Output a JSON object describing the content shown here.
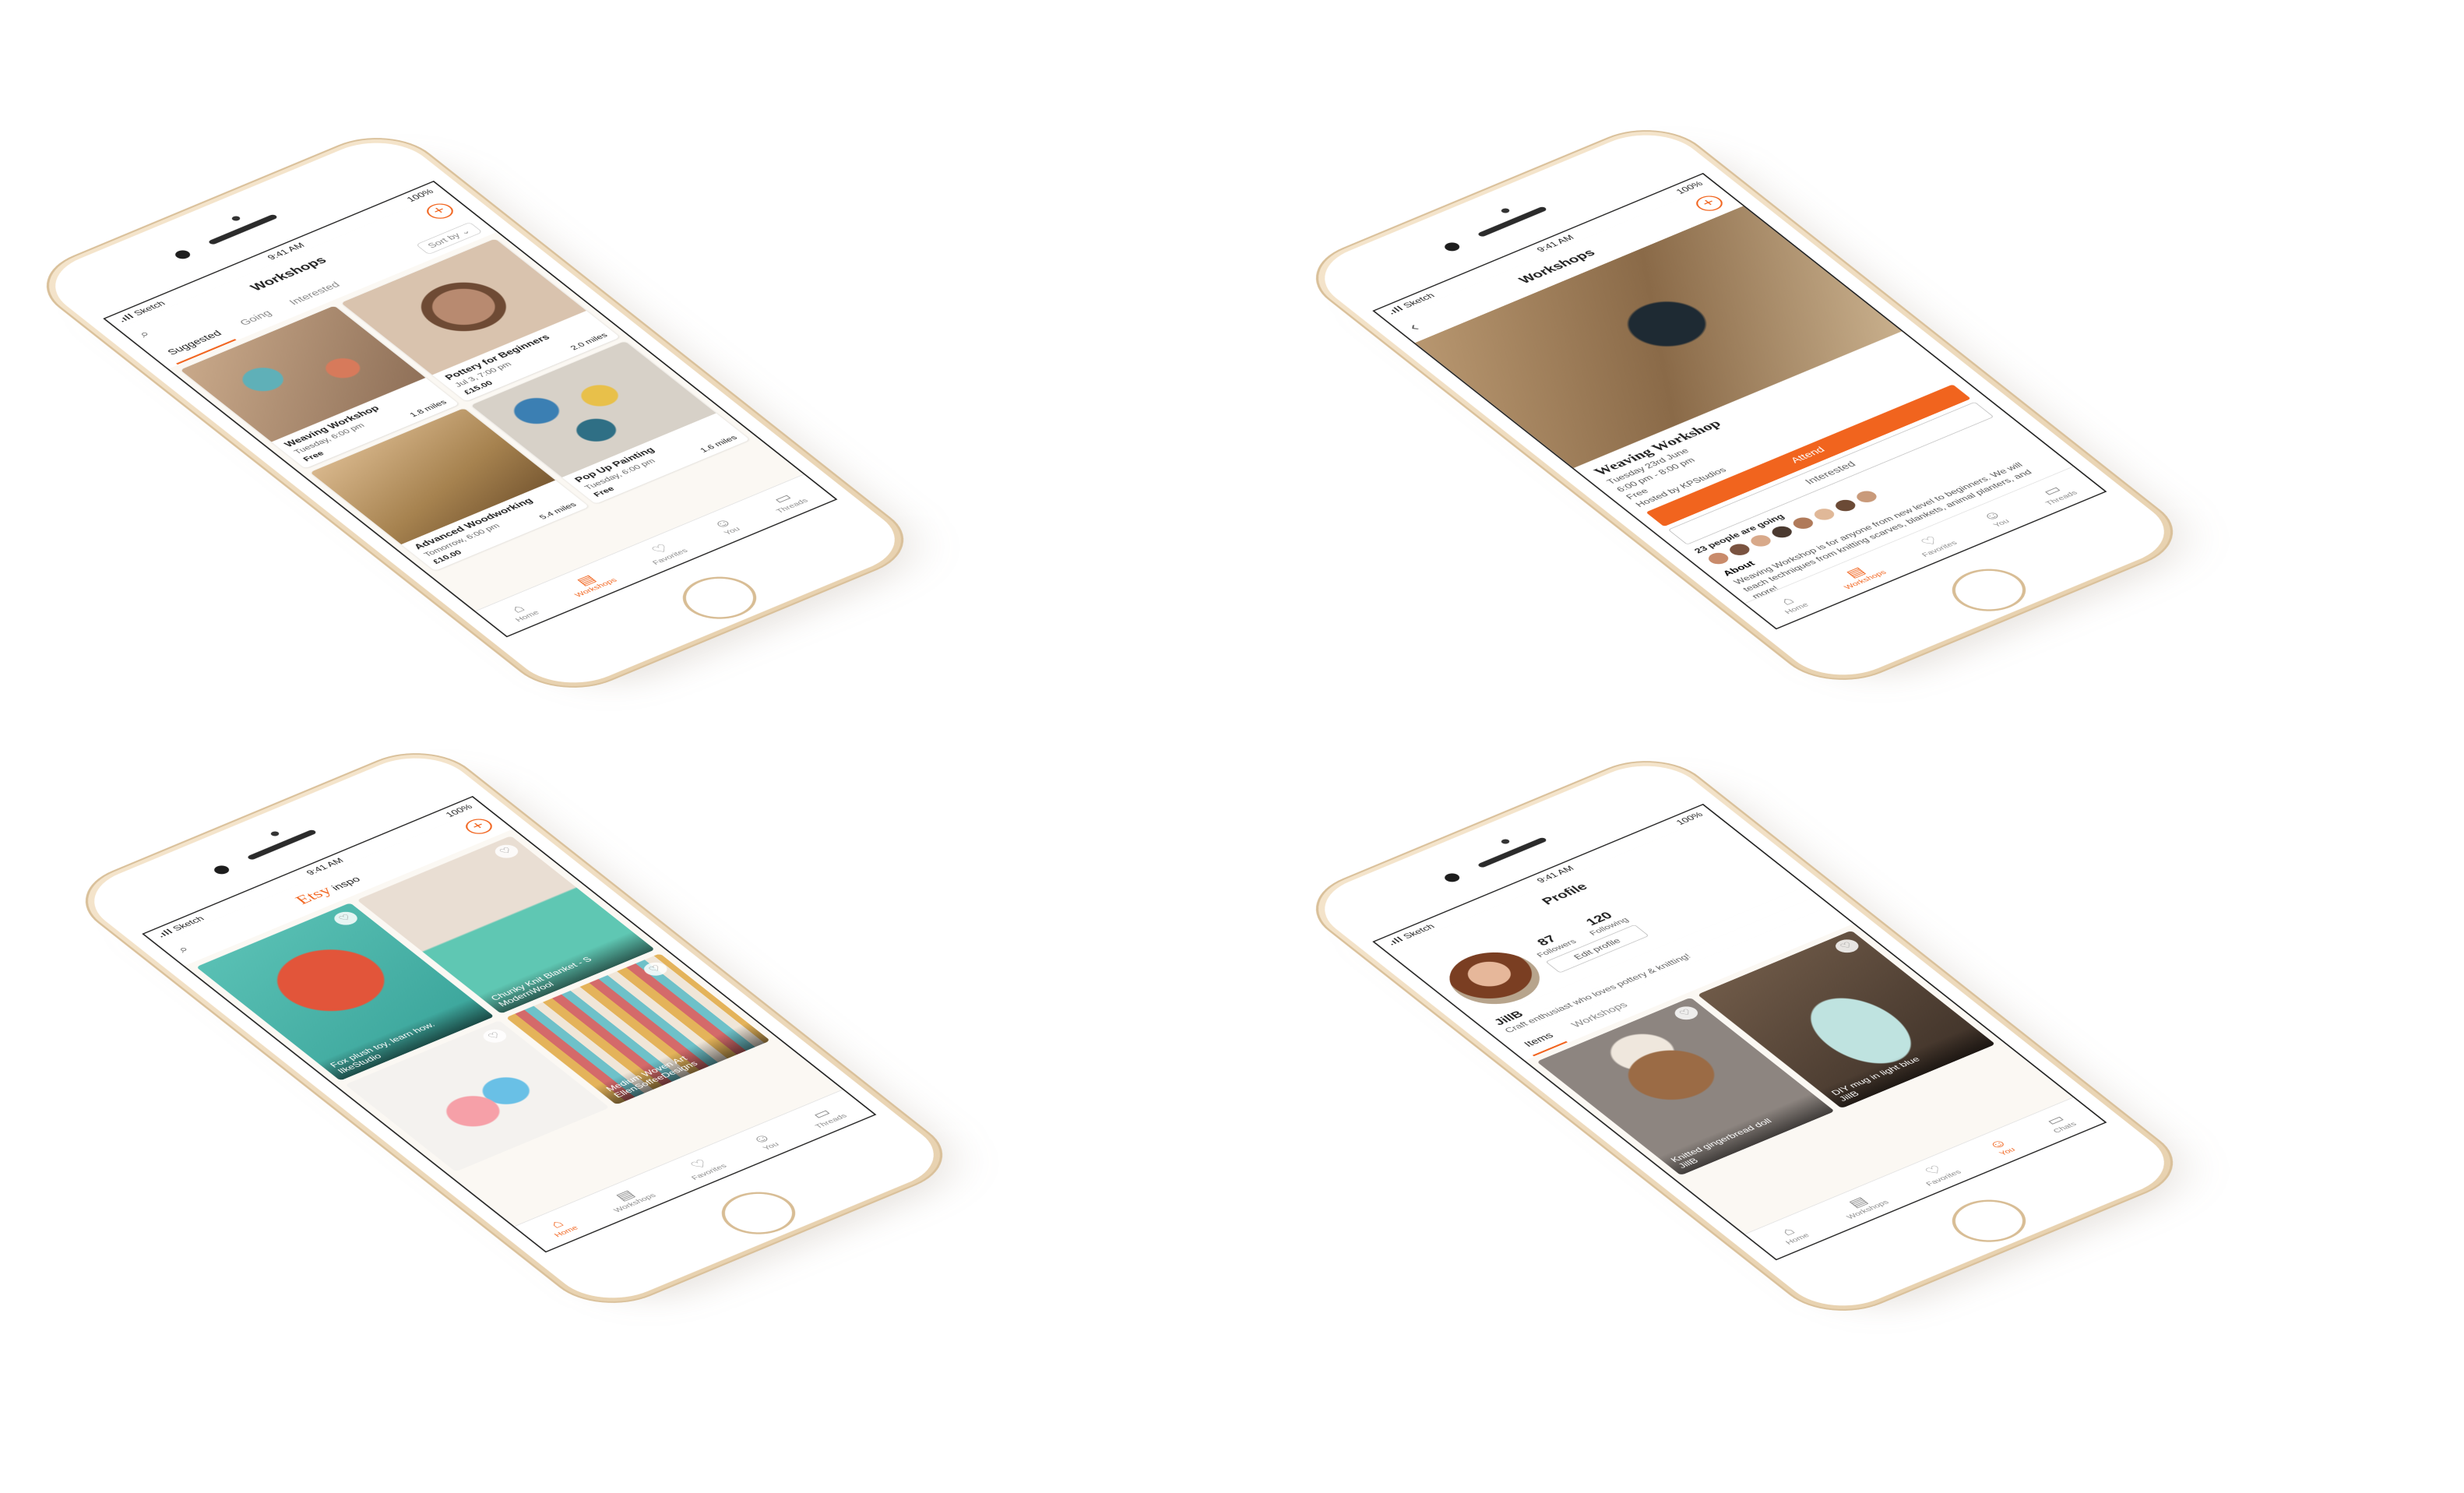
{
  "colors": {
    "accent": "#f1641e",
    "device": "#ecd6b4",
    "screen_bg": "#fbf8f3"
  },
  "status": {
    "carrier": "Sketch",
    "time": "9:41 AM",
    "battery": "100%"
  },
  "tabbar": {
    "home": "Home",
    "workshops": "Workshops",
    "favorites": "Favorites",
    "you": "You",
    "threads": "Threads",
    "chats": "Chats"
  },
  "phone_workshops": {
    "title": "Workshops",
    "tabs": [
      "Suggested",
      "Going",
      "Interested"
    ],
    "sort_label": "Sort by",
    "cards": [
      {
        "title": "Weaving Workshop",
        "when": "Tuesday, 6:00 pm",
        "price": "Free",
        "distance": "1.8 miles"
      },
      {
        "title": "Pottery for Beginners",
        "when": "Jul 3, 7:00 pm",
        "price": "£15.00",
        "distance": "2.0 miles"
      },
      {
        "title": "Advanced Woodworking",
        "when": "Tomorrow, 6:00 pm",
        "price": "£10.00",
        "distance": "5.4 miles"
      },
      {
        "title": "Pop Up Painting",
        "when": "Tuesday, 6:00 pm",
        "price": "Free",
        "distance": "1.6 miles"
      }
    ]
  },
  "phone_detail": {
    "title": "Workshops",
    "event_title": "Weaving Workshop",
    "date": "Tuesday 23rd June",
    "time": "6:00 pm - 8:00 pm",
    "price": "Free",
    "host": "Hosted by KPStudios",
    "attend_label": "Attend",
    "interested_label": "Interested",
    "going_text": "23 people are going",
    "about_heading": "About",
    "about_text": "Weaving Workshop is for anyone from new level to beginners. We will teach techniques from knitting scarves, blankets, animal planters, and more!"
  },
  "phone_inspo": {
    "logo": "Etsy",
    "logo_suffix": "inspo",
    "cards": [
      {
        "caption": "Fox plush toy, learn how.",
        "author": "IlkeStudio"
      },
      {
        "caption": "Chunky Knit Blanket - S",
        "author": "ModernWool"
      },
      {
        "caption": "",
        "author": ""
      },
      {
        "caption": "Medium Woven Art",
        "author": "EllenSoffeeDesigns"
      }
    ]
  },
  "phone_profile": {
    "title": "Profile",
    "name": "JillB",
    "bio": "Craft enthusiast who loves pottery & knitting!",
    "followers_count": "87",
    "followers_label": "Followers",
    "following_count": "120",
    "following_label": "Following",
    "edit_label": "Edit profile",
    "tabs": [
      "Items",
      "Workshops"
    ],
    "items": [
      {
        "caption": "Knitted gingerbread doll",
        "author": "JillB"
      },
      {
        "caption": "DIY mug in light blue",
        "author": "JillB"
      }
    ]
  }
}
